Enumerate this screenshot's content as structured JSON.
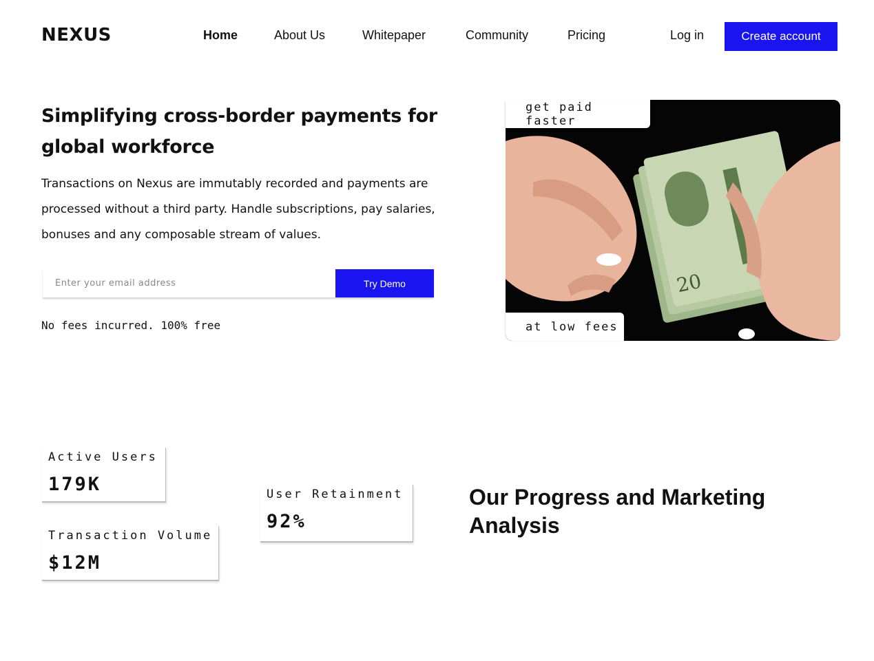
{
  "header": {
    "logo": "NEXUS",
    "nav": [
      {
        "label": "Home",
        "active": true
      },
      {
        "label": "About Us",
        "active": false
      },
      {
        "label": "Whitepaper",
        "active": false
      },
      {
        "label": "Community",
        "active": false
      },
      {
        "label": "Pricing",
        "active": false
      }
    ],
    "login_label": "Log in",
    "create_account_label": "Create account"
  },
  "hero": {
    "title": "Simplifying cross-border payments for global workforce",
    "description": "Transactions on Nexus are immutably recorded and payments are processed without a third party. Handle subscriptions, pay salaries, bonuses and any composable stream of values.",
    "email_placeholder": "Enter your email address",
    "email_value": "",
    "demo_button": "Try Demo",
    "note": "No fees incurred. 100% free",
    "image_tag_top": "get paid faster",
    "image_tag_bottom": "at low fees"
  },
  "stats": {
    "active_users": {
      "label": "Active Users",
      "value": "179K"
    },
    "user_retention": {
      "label": "User Retainment",
      "value": "92%"
    },
    "transaction_volume": {
      "label": "Transaction Volume",
      "value": "$12M"
    }
  },
  "progress": {
    "title": "Our Progress and Marketing Analysis"
  },
  "colors": {
    "accent": "#1a14f0",
    "text": "#111111",
    "background": "#ffffff"
  }
}
